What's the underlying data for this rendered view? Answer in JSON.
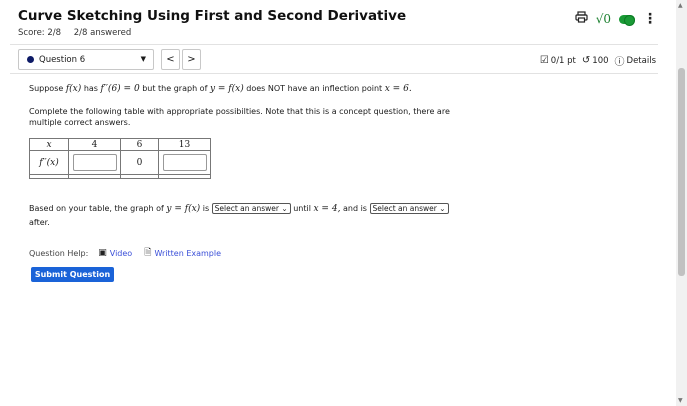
{
  "header": {
    "title": "Curve Sketching Using First and Second Derivative",
    "score": "Score: 2/8",
    "answered": "2/8 answered",
    "icons": [
      "print-icon",
      "sqrt-icon",
      "toggle-icon",
      "more-vertical-icon"
    ],
    "sqrt_label": "√0"
  },
  "nav": {
    "question_label": "Question 6",
    "prev": "<",
    "next": ">",
    "points": "0/1 pt",
    "attempts": "100",
    "details": "Details"
  },
  "question": {
    "p1_a": "Suppose",
    "p1_f": "f(x)",
    "p1_b": "has",
    "p1_cond": "f′′(6) = 0",
    "p1_c": "but the graph of",
    "p1_y": "y = f(x)",
    "p1_d": "does NOT have an inflection point",
    "p1_x": "x = 6.",
    "p2": "Complete the following table with appropriate possibilties. Note that this is a concept question, there are multiple correct answers.",
    "table": {
      "header": [
        "x",
        "4",
        "6",
        "13"
      ],
      "row_label": "f′′(x)",
      "mid_value": "0"
    },
    "p3_a": "Based on your table, the graph of",
    "p3_y": "y = f(x)",
    "p3_b": "is",
    "select_placeholder": "Select an answer",
    "p3_c": "until",
    "p3_x": "x = 4,",
    "p3_d": "and is",
    "p3_e": "after."
  },
  "help": {
    "label": "Question Help:",
    "video": "Video",
    "example": "Written Example"
  },
  "submit_label": "Submit Question",
  "colors": {
    "accent": "#1a63d8",
    "link": "#3a4fd8",
    "toggle": "#1a9a36"
  }
}
